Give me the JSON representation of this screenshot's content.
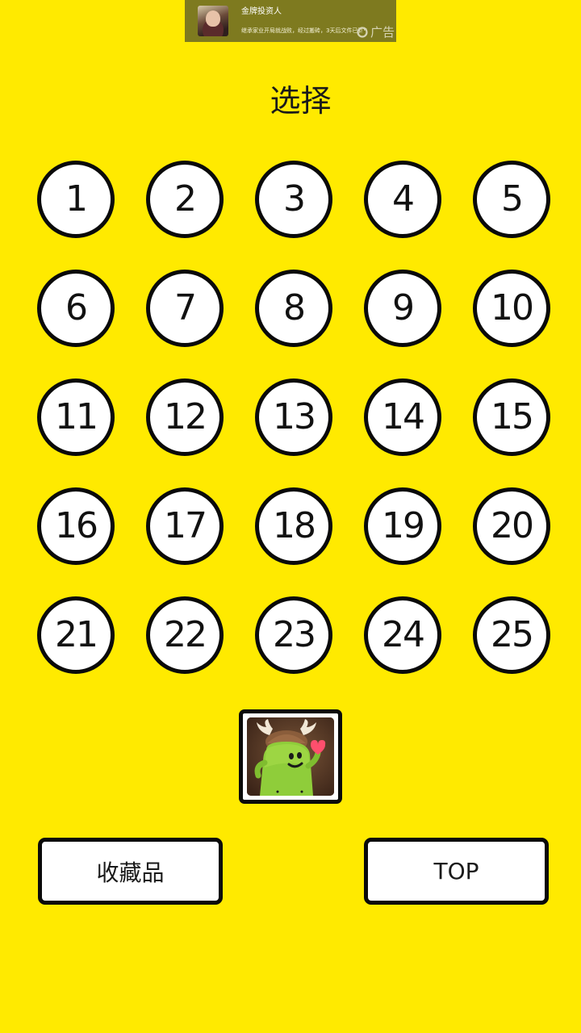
{
  "ad": {
    "title": "金牌投资人",
    "description": "继承家业开局就战败，经过搬砖，3天后文件已到，挑",
    "label": "广告",
    "icon": "ad-refresh-icon"
  },
  "page": {
    "title": "选择"
  },
  "levels": [
    "1",
    "2",
    "3",
    "4",
    "5",
    "6",
    "7",
    "8",
    "9",
    "10",
    "11",
    "12",
    "13",
    "14",
    "15",
    "16",
    "17",
    "18",
    "19",
    "20",
    "21",
    "22",
    "23",
    "24",
    "25"
  ],
  "character": {
    "icon": "green-bean-character-with-antlers"
  },
  "buttons": {
    "collection": "收藏品",
    "top": "TOP"
  },
  "colors": {
    "background": "#ffea00",
    "border": "#0a0a0a",
    "button_fill": "#ffffff",
    "ad_background": "#7e7a1f"
  }
}
